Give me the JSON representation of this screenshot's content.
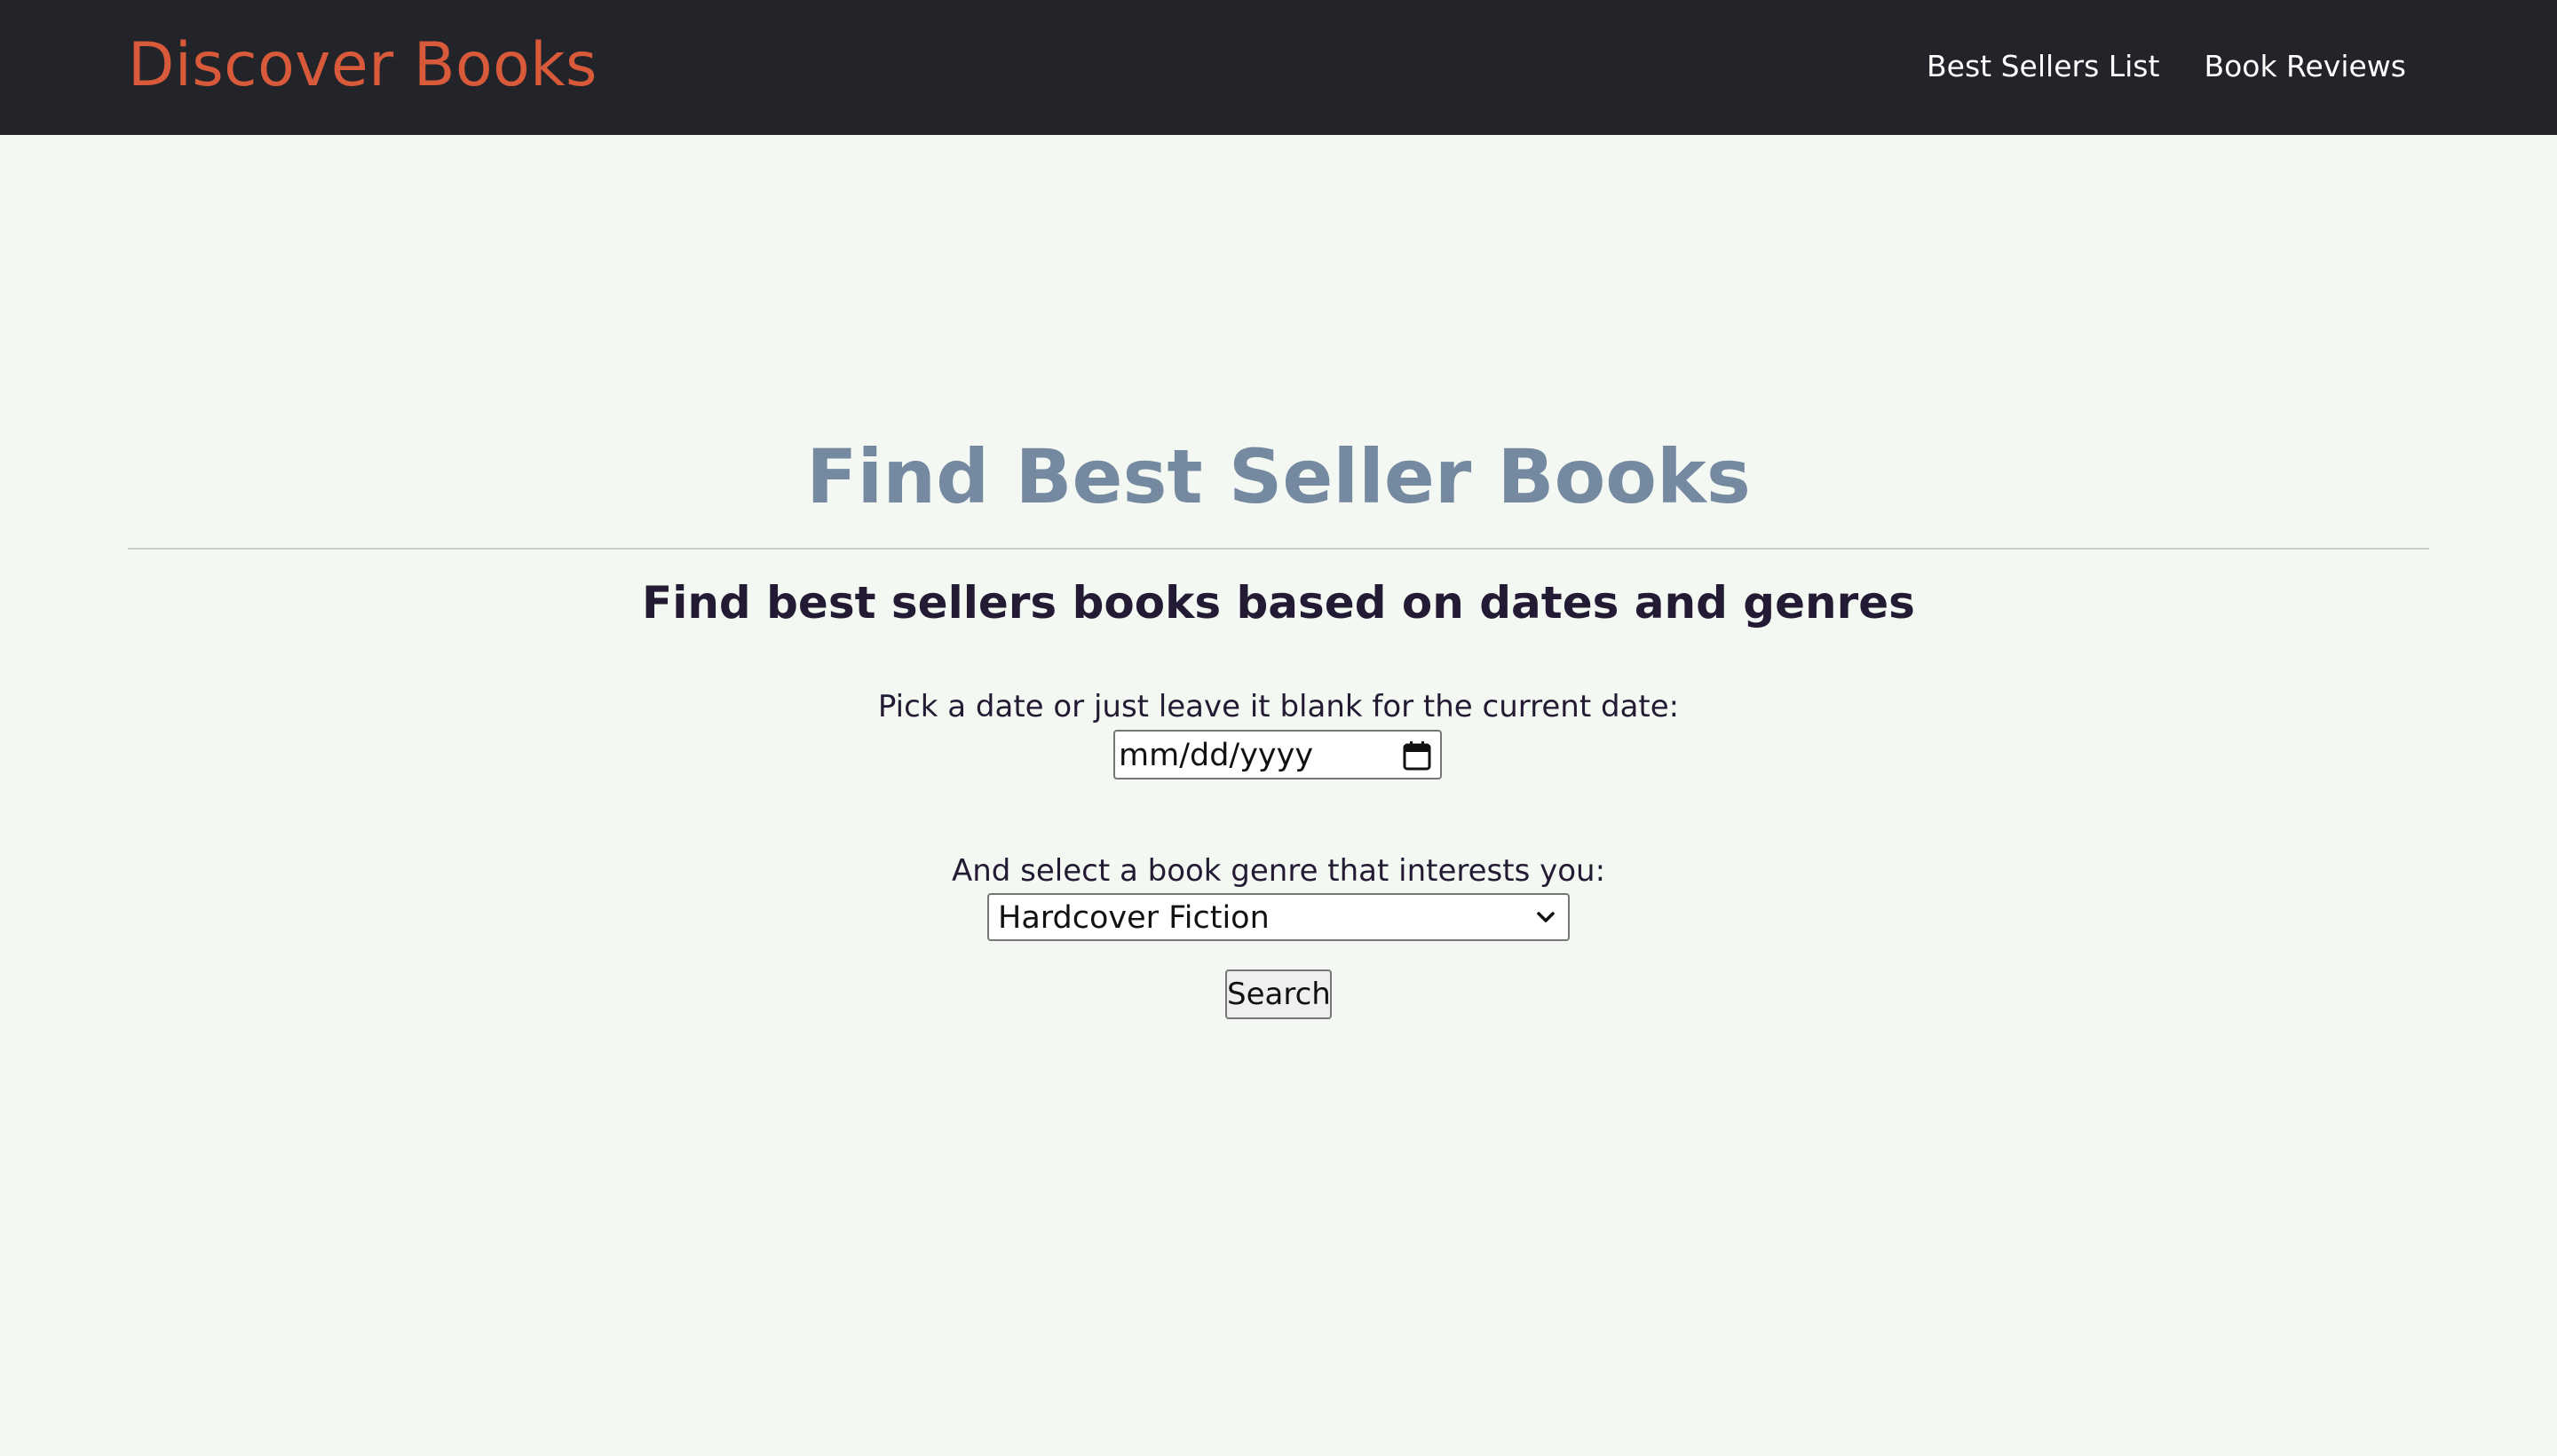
{
  "navbar": {
    "brand": "Discover Books",
    "links": [
      {
        "label": "Best Sellers List"
      },
      {
        "label": "Book Reviews"
      }
    ]
  },
  "main": {
    "title": "Find Best Seller Books",
    "subtitle": "Find best sellers books based on dates and genres",
    "date_label": "Pick a date or just leave it blank for the current date:",
    "date_placeholder": "mm/dd/yyyy",
    "genre_label": "And select a book genre that interests you:",
    "genre_selected": "Hardcover Fiction",
    "search_label": "Search"
  },
  "colors": {
    "navbar_bg": "#222429",
    "brand": "#d85a3a",
    "page_bg": "#f4f8f3",
    "title": "#7589a0",
    "text": "#221b33"
  },
  "icons": {
    "date_picker": "calendar-icon",
    "select": "chevron-down-icon"
  }
}
